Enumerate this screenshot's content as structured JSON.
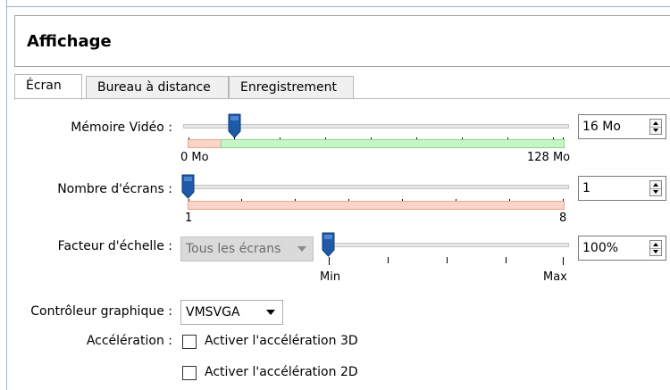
{
  "header": {
    "title": "Affichage"
  },
  "tabs": [
    {
      "label": "Écran",
      "active": true
    },
    {
      "label": "Bureau à distance",
      "active": false
    },
    {
      "label": "Enregistrement",
      "active": false
    }
  ],
  "video_memory": {
    "label": "Mémoire Vidéo :",
    "value": "16 Mo",
    "min_label": "0 Mo",
    "max_label": "128 Mo",
    "value_mb": 16,
    "max_mb": 128
  },
  "monitor_count": {
    "label": "Nombre d'écrans :",
    "value": "1",
    "min_label": "1",
    "max_label": "8"
  },
  "scale_factor": {
    "label": "Facteur d'échelle :",
    "combo_value": "Tous les écrans",
    "value": "100%",
    "min_label": "Min",
    "max_label": "Max"
  },
  "graphics_controller": {
    "label": "Contrôleur graphique :",
    "value": "VMSVGA"
  },
  "acceleration": {
    "label": "Accélération :",
    "enable_3d": "Activer l'accélération 3D",
    "enable_2d": "Activer l'accélération 2D",
    "checked_3d": false,
    "checked_2d": false
  },
  "colors": {
    "thumb": "#1e5aa8",
    "red_zone": "#f9d4c7",
    "green_zone": "#c7f5c7"
  }
}
